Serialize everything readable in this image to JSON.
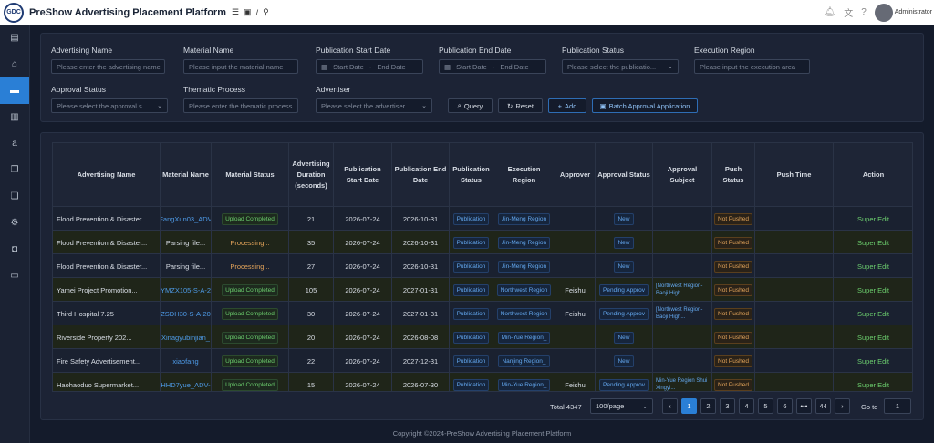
{
  "app": {
    "logo": "GDC",
    "title": "PreShow Advertising Placement Platform",
    "breadcrumb_sep": "/",
    "user": "Administrator"
  },
  "filters": {
    "ad_name": {
      "label": "Advertising Name",
      "placeholder": "Please enter the advertising name"
    },
    "material_name": {
      "label": "Material Name",
      "placeholder": "Please input the material name"
    },
    "pub_start": {
      "label": "Publication Start Date",
      "start": "Start Date",
      "sep": "-",
      "end": "End Date"
    },
    "pub_end": {
      "label": "Publication End Date",
      "start": "Start Date",
      "sep": "-",
      "end": "End Date"
    },
    "pub_status": {
      "label": "Publication Status",
      "placeholder": "Please select the publicatio..."
    },
    "exec_region": {
      "label": "Execution Region",
      "placeholder": "Please input the execution area"
    },
    "approval_status": {
      "label": "Approval Status",
      "placeholder": "Please select the approval s..."
    },
    "thematic": {
      "label": "Thematic Process",
      "placeholder": "Please enter the thematic process"
    },
    "advertiser": {
      "label": "Advertiser",
      "placeholder": "Please select the advertiser"
    }
  },
  "buttons": {
    "query": "Query",
    "reset": "Reset",
    "add": "Add",
    "batch": "Batch Approval Application"
  },
  "table": {
    "headers": [
      "Advertising Name",
      "Material Name",
      "Material Status",
      "Advertising Duration (seconds)",
      "Publication Start Date",
      "Publication End Date",
      "Publication Status",
      "Execution Region",
      "Approver",
      "Approval Status",
      "Approval Subject",
      "Push Status",
      "Push Time",
      "Action"
    ],
    "rows": [
      {
        "name": "Flood Prevention & Disaster...",
        "material": "FangXun03_ADV",
        "mstatus": "Upload Completed",
        "duration": "21",
        "start": "2026-07-24",
        "end": "2026-10-31",
        "pubstatus": "Publication",
        "region": "Jin-Meng Region",
        "approver": "",
        "approval": "New",
        "subject": "",
        "push": "Not Pushed",
        "action": "Super Edit"
      },
      {
        "name": "Flood Prevention & Disaster...",
        "material": "Parsing file...",
        "mstatus": "Processing...",
        "duration": "35",
        "start": "2026-07-24",
        "end": "2026-10-31",
        "pubstatus": "Publication",
        "region": "Jin-Meng Region",
        "approver": "",
        "approval": "New",
        "subject": "",
        "push": "Not Pushed",
        "action": "Super Edit"
      },
      {
        "name": "Flood Prevention & Disaster...",
        "material": "Parsing file...",
        "mstatus": "Processing...",
        "duration": "27",
        "start": "2026-07-24",
        "end": "2026-10-31",
        "pubstatus": "Publication",
        "region": "Jin-Meng Region",
        "approver": "",
        "approval": "New",
        "subject": "",
        "push": "Not Pushed",
        "action": "Super Edit"
      },
      {
        "name": "Yamei Project Promotion...",
        "material": "YMZX105-S-A-2",
        "mstatus": "Upload Completed",
        "duration": "105",
        "start": "2026-07-24",
        "end": "2027-01-31",
        "pubstatus": "Publication",
        "region": "Northwest Region",
        "approver": "Feishu",
        "approval": "Pending Approv",
        "subject": "[Northwest Region-Baoji High...",
        "push": "Not Pushed",
        "action": "Super Edit"
      },
      {
        "name": "Third Hospital 7.25",
        "material": "ZSDH30-S-A-20",
        "mstatus": "Upload Completed",
        "duration": "30",
        "start": "2026-07-24",
        "end": "2027-01-31",
        "pubstatus": "Publication",
        "region": "Northwest Region",
        "approver": "Feishu",
        "approval": "Pending Approv",
        "subject": "[Northwest Region-Baoji High...",
        "push": "Not Pushed",
        "action": "Super Edit"
      },
      {
        "name": "Riverside Property 202...",
        "material": "Xinagyubinjian_",
        "mstatus": "Upload Completed",
        "duration": "20",
        "start": "2026-07-24",
        "end": "2026-08-08",
        "pubstatus": "Publication",
        "region": "Min-Yue Region_",
        "approver": "",
        "approval": "New",
        "subject": "",
        "push": "Not Pushed",
        "action": "Super Edit"
      },
      {
        "name": "Fire Safety Advertisement...",
        "material": "xiaofang",
        "mstatus": "Upload Completed",
        "duration": "22",
        "start": "2026-07-24",
        "end": "2027-12-31",
        "pubstatus": "Publication",
        "region": "Nanjing Region_",
        "approver": "",
        "approval": "New",
        "subject": "",
        "push": "Not Pushed",
        "action": "Super Edit"
      },
      {
        "name": "Haohaoduo Supermarket...",
        "material": "HHD7yue_ADV-",
        "mstatus": "Upload Completed",
        "duration": "15",
        "start": "2026-07-24",
        "end": "2026-07-30",
        "pubstatus": "Publication",
        "region": "Min-Yue Region_",
        "approver": "Feishu",
        "approval": "Pending Approv",
        "subject": "Min-Yue Region Shui Xingyi...",
        "push": "Not Pushed",
        "action": "Super Edit"
      }
    ]
  },
  "pagination": {
    "total": "Total 4347",
    "page_size": "100/page",
    "pages": [
      "1",
      "2",
      "3",
      "4",
      "5",
      "6",
      "•••",
      "44"
    ],
    "prev": "‹",
    "next": "›",
    "goto_label": "Go to",
    "goto_value": "1"
  },
  "footer": "Copyright ©2024-PreShow Advertising Placement Platform"
}
